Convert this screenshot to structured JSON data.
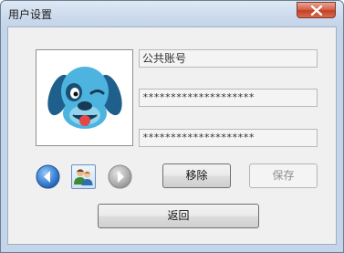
{
  "window": {
    "title": "用户设置"
  },
  "account": {
    "username": "公共账号",
    "password": "********************",
    "confirm_password": "********************"
  },
  "buttons": {
    "remove": "移除",
    "save": "保存",
    "back": "返回"
  },
  "icons": {
    "avatar": "blue-dog-avatar-icon",
    "previous": "arrow-left-icon",
    "users": "users-icon",
    "next": "arrow-right-icon",
    "close": "close-icon"
  },
  "colors": {
    "titlebar": "#c9d8eb",
    "close_button": "#d5654e",
    "client_background": "#f0f0f0",
    "prev_arrow": "#3f86d8",
    "disabled_arrow": "#a8a8a8"
  }
}
